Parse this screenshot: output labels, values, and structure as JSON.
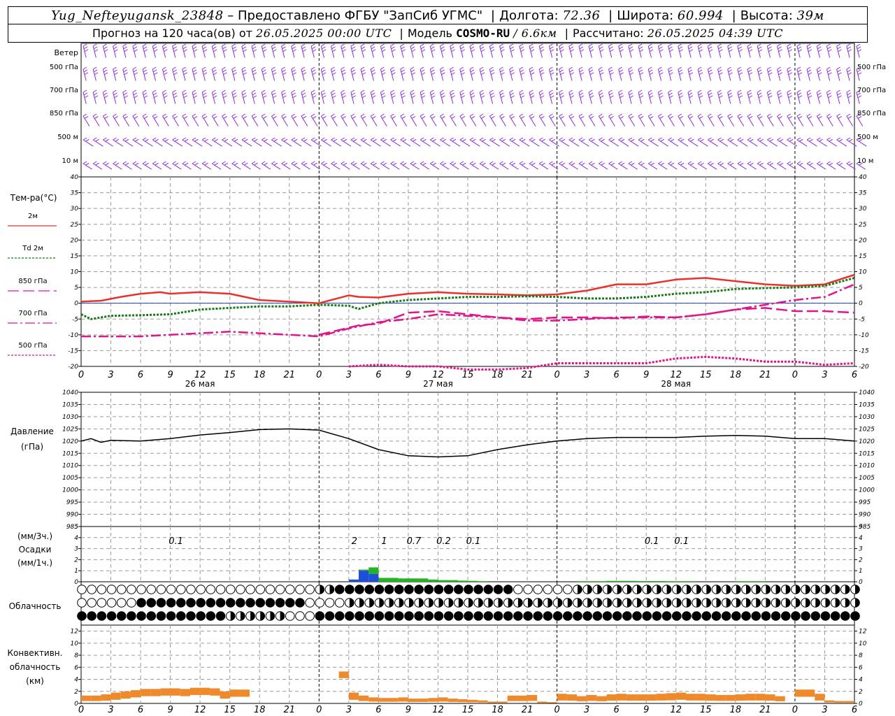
{
  "header": {
    "station": "Yug_Nefteyugansk_23848",
    "provided": "– Предоставлено ФГБУ \"ЗапСиб УГМС\"",
    "lon_label": "Долгота:",
    "lon": "72.36",
    "lat_label": "Широта:",
    "lat": "60.994",
    "alt_label": "Высота:",
    "alt": "39м",
    "fc_prefix": "Прогноз на 120 часа(ов) от",
    "fc_time": "26.05.2025 00:00 UTC",
    "model_label": "Модель",
    "model": "COSMO-RU",
    "model_res": "/ 6.6км",
    "calc_label": "Рассчитано:",
    "calc_time": "26.05.2025 04:39 UTC"
  },
  "colors": {
    "wind": "#8a2be2",
    "t2m": "#e8322c",
    "td2m": "#1a7a1a",
    "t850": "#e0158c",
    "t700": "#e0158c",
    "t500": "#e0158c",
    "pressure": "#000000",
    "precip_blue": "#1f4fd8",
    "precip_green": "#22b422",
    "conv": "#ef8a2c",
    "grid": "#9a9a9a"
  },
  "wind_panel": {
    "title": "Ветер",
    "levels": [
      "500 гПа",
      "700 гПа",
      "850 гПа",
      "500 м",
      "10  м"
    ]
  },
  "temp_panel": {
    "title": "Тем-ра(°C)",
    "legend": [
      {
        "label": "2м",
        "style": "solid"
      },
      {
        "label": "Td  2м",
        "style": "dotted"
      },
      {
        "label": "850 гПа",
        "style": "longdash"
      },
      {
        "label": "700 гПа",
        "style": "dashdot"
      },
      {
        "label": "500 гПа",
        "style": "dot"
      }
    ]
  },
  "pressure_panel": {
    "title": "Давление",
    "unit": "(гПа)"
  },
  "precip_panel": {
    "unit3h": "(мм/3ч.)",
    "title": "Осадки",
    "unit1h": "(мм/1ч.)",
    "amounts": [
      {
        "hour": 9,
        "text": "0.1"
      },
      {
        "hour": 27,
        "text": "2"
      },
      {
        "hour": 30,
        "text": "1"
      },
      {
        "hour": 33,
        "text": "0.7"
      },
      {
        "hour": 36,
        "text": "0.2"
      },
      {
        "hour": 39,
        "text": "0.1"
      },
      {
        "hour": 57,
        "text": "0.1"
      },
      {
        "hour": 60,
        "text": "0.1"
      }
    ]
  },
  "cloud_panel": {
    "title": "Облачность"
  },
  "conv_panel": {
    "title1": "Конвективн.",
    "title2": "облачность",
    "unit": "(км)"
  },
  "chart_data": [
    {
      "type": "line",
      "name": "temperature",
      "x_unit": "hours from 26.05.2025 00:00 UTC",
      "x_tick_labels": [
        "0",
        "3",
        "6",
        "9",
        "12",
        "15",
        "18",
        "21"
      ],
      "date_labels": [
        "26 мая",
        "27 мая",
        "28 мая"
      ],
      "ylabel": "Тем-ра(°C)",
      "ylim": [
        -20,
        40
      ],
      "yticks": [
        -20,
        -15,
        -10,
        -5,
        0,
        5,
        10,
        15,
        20,
        25,
        30,
        35,
        40
      ],
      "grid": true,
      "series": [
        {
          "name": "2м",
          "x": [
            0,
            2,
            4,
            6,
            8,
            9,
            10,
            12,
            15,
            18,
            21,
            24,
            27,
            28,
            30,
            33,
            36,
            39,
            42,
            45,
            48,
            51,
            54,
            57,
            60,
            63,
            66,
            69,
            72,
            75,
            78
          ],
          "values": [
            0.5,
            0.8,
            2,
            3,
            3.5,
            3,
            3.2,
            3.5,
            3,
            1,
            0.5,
            0,
            2.5,
            2,
            1.8,
            3,
            3.5,
            3,
            2.8,
            2.5,
            2.8,
            4,
            6,
            6,
            7.5,
            8,
            7,
            6,
            5.5,
            6,
            9
          ]
        },
        {
          "name": "Td  2м",
          "x": [
            0,
            1,
            3,
            6,
            9,
            12,
            15,
            18,
            21,
            24,
            27,
            28,
            30,
            33,
            36,
            39,
            42,
            45,
            48,
            51,
            54,
            57,
            60,
            63,
            66,
            69,
            72,
            75,
            78
          ],
          "values": [
            -3.5,
            -5,
            -4,
            -3.8,
            -3.5,
            -2,
            -1.5,
            -1,
            -1,
            -0.5,
            -0.8,
            -1.8,
            0,
            1,
            1.5,
            2,
            2,
            2.2,
            2,
            1.5,
            1.5,
            2,
            3,
            3.5,
            4.5,
            4.8,
            5,
            5.5,
            8
          ]
        },
        {
          "name": "850 гПа",
          "x": [
            24,
            26,
            28,
            30,
            33,
            36,
            39,
            42,
            45,
            48,
            51,
            54,
            57,
            60,
            63,
            66,
            69,
            72,
            75,
            78
          ],
          "values": [
            -10,
            -8.5,
            -7,
            -6.5,
            -3,
            -2.5,
            -3.5,
            -4.5,
            -5,
            -4.5,
            -4.5,
            -4.8,
            -4.2,
            -4.5,
            -3.5,
            -2,
            -1.5,
            -2.5,
            -2.5,
            -3
          ]
        },
        {
          "name": "700 гПа",
          "x": [
            0,
            3,
            6,
            9,
            12,
            15,
            18,
            21,
            24,
            27,
            30,
            33,
            36,
            39,
            42,
            45,
            48,
            51,
            54,
            57,
            60,
            63,
            66,
            69,
            72,
            75,
            78
          ],
          "values": [
            -10.5,
            -10.5,
            -10.5,
            -10,
            -9.5,
            -9,
            -9.5,
            -10,
            -10.5,
            -8,
            -6,
            -5,
            -3.5,
            -4,
            -4.5,
            -5.5,
            -5.5,
            -5,
            -4.5,
            -4.5,
            -4.5,
            -3.5,
            -2,
            -0.5,
            1,
            2,
            6
          ]
        },
        {
          "name": "500 гПа",
          "x": [
            27,
            30,
            33,
            36,
            39,
            42,
            45,
            48,
            51,
            54,
            57,
            60,
            63,
            66,
            69,
            72,
            75,
            78
          ],
          "values": [
            -20,
            -19.5,
            -20,
            -20,
            -21,
            -21,
            -20.5,
            -19,
            -19,
            -19,
            -19,
            -17.5,
            -17,
            -17.5,
            -18.5,
            -18.5,
            -19.5,
            -19
          ]
        }
      ]
    },
    {
      "type": "line",
      "name": "pressure",
      "ylabel": "Давление (гПа)",
      "ylim": [
        985,
        1040
      ],
      "yticks": [
        985,
        990,
        995,
        1000,
        1005,
        1010,
        1015,
        1020,
        1025,
        1030,
        1035,
        1040
      ],
      "grid": true,
      "series": [
        {
          "x": [
            0,
            1,
            2,
            3,
            6,
            9,
            12,
            15,
            18,
            21,
            24,
            27,
            30,
            33,
            36,
            39,
            42,
            45,
            48,
            51,
            54,
            57,
            60,
            63,
            66,
            69,
            72,
            75,
            78
          ],
          "values": [
            1020,
            1021,
            1019.5,
            1020.3,
            1020,
            1021,
            1022.5,
            1023.5,
            1024.7,
            1025,
            1024.5,
            1021,
            1016.5,
            1014,
            1013.5,
            1014,
            1016.5,
            1018.5,
            1020,
            1021,
            1021.5,
            1021.5,
            1021.5,
            1022,
            1022.3,
            1022,
            1021,
            1021,
            1020
          ]
        }
      ]
    },
    {
      "type": "bar",
      "name": "precipitation",
      "ylabel": "Осадки (мм/1ч.)",
      "ylim": [
        0,
        5
      ],
      "yticks": [
        0,
        1,
        2,
        3,
        4,
        5
      ],
      "series": [
        {
          "name": "blue",
          "x": [
            27,
            28,
            29
          ],
          "values": [
            0.2,
            1.0,
            0.7
          ]
        },
        {
          "name": "green",
          "x": [
            28,
            29,
            30,
            31,
            32,
            33,
            34,
            35,
            36,
            37,
            38,
            39,
            40,
            50,
            51,
            52,
            53,
            54,
            55,
            56,
            57,
            58,
            59,
            60,
            61,
            66,
            67,
            68
          ],
          "values": [
            0.1,
            0.6,
            0.35,
            0.35,
            0.3,
            0.3,
            0.3,
            0.2,
            0.15,
            0.15,
            0.1,
            0.08,
            0.05,
            0.05,
            0.05,
            0.05,
            0.08,
            0.08,
            0.08,
            0.06,
            0.06,
            0.06,
            0.05,
            0.05,
            0.05,
            0.05,
            0.05,
            0.05
          ]
        }
      ]
    },
    {
      "type": "bar",
      "name": "convective cloud",
      "ylabel": "Конвективн. облачность (км)",
      "ylim": [
        0,
        13
      ],
      "yticks": [
        0,
        2,
        4,
        6,
        8,
        10,
        12
      ],
      "series": [
        {
          "x": [
            0,
            1,
            2,
            3,
            4,
            5,
            6,
            7,
            8,
            9,
            10,
            11,
            12,
            13,
            14,
            15,
            16,
            26,
            27,
            28,
            29,
            30,
            31,
            32,
            33,
            34,
            35,
            36,
            37,
            38,
            39,
            40,
            41,
            42,
            43,
            44,
            45,
            46,
            47,
            48,
            49,
            50,
            51,
            52,
            53,
            54,
            55,
            56,
            57,
            58,
            59,
            60,
            61,
            62,
            63,
            64,
            65,
            66,
            67,
            68,
            69,
            70,
            72,
            73,
            74,
            75,
            76,
            77
          ],
          "values": [
            1.3,
            1.3,
            1.5,
            1.8,
            2.0,
            2.2,
            2.4,
            2.4,
            2.5,
            2.5,
            2.4,
            2.6,
            2.6,
            2.5,
            2.0,
            2.3,
            2.3,
            5.3,
            1.8,
            1.3,
            1.0,
            0.9,
            0.9,
            1.0,
            0.8,
            0.8,
            0.9,
            1.0,
            0.8,
            0.7,
            0.6,
            0.5,
            0.3,
            0.3,
            1.3,
            1.3,
            1.4,
            0.3,
            0.2,
            1.6,
            1.5,
            1.2,
            1.4,
            1.2,
            1.5,
            1.6,
            1.5,
            1.5,
            1.5,
            1.6,
            1.7,
            1.8,
            1.6,
            1.6,
            1.5,
            1.4,
            1.4,
            1.5,
            1.6,
            1.6,
            1.5,
            1.2,
            2.3,
            2.3,
            1.6,
            0.5,
            0.4,
            0.4
          ]
        }
      ]
    }
  ]
}
